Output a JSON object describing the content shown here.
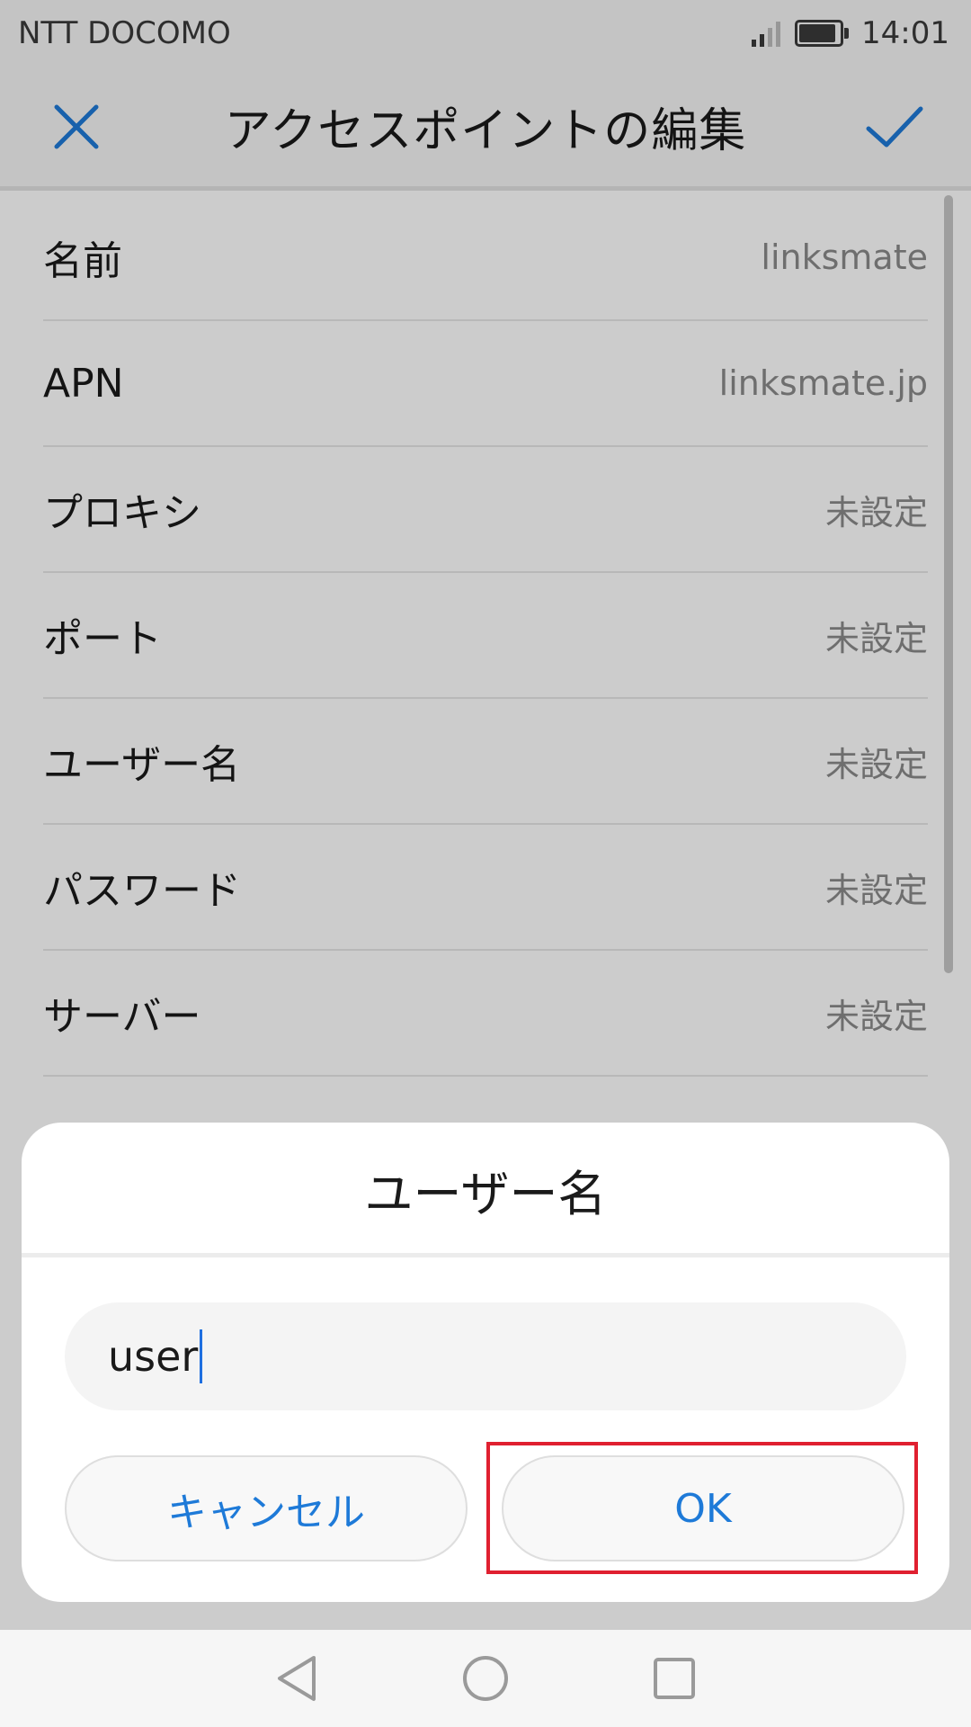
{
  "status_bar": {
    "carrier": "NTT DOCOMO",
    "time": "14:01",
    "battery_level": 0.9
  },
  "app_bar": {
    "title": "アクセスポイントの編集",
    "close_icon": "close-icon",
    "confirm_icon": "check-icon"
  },
  "settings": [
    {
      "label": "名前",
      "value": "linksmate"
    },
    {
      "label": "APN",
      "value": "linksmate.jp"
    },
    {
      "label": "プロキシ",
      "value": "未設定"
    },
    {
      "label": "ポート",
      "value": "未設定"
    },
    {
      "label": "ユーザー名",
      "value": "未設定"
    },
    {
      "label": "パスワード",
      "value": "未設定"
    },
    {
      "label": "サーバー",
      "value": "未設定"
    }
  ],
  "dialog": {
    "title": "ユーザー名",
    "input_value": "user",
    "cancel_label": "キャンセル",
    "ok_label": "OK"
  },
  "colors": {
    "accent": "#1e7ad8",
    "highlight": "#e02030"
  },
  "nav": {
    "back_icon": "back-icon",
    "home_icon": "home-icon",
    "recents_icon": "recents-icon"
  }
}
